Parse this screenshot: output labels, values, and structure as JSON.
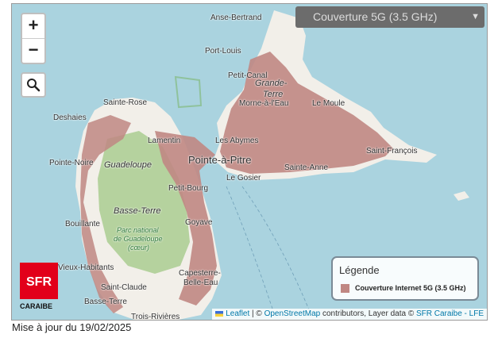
{
  "map": {
    "layer_select": {
      "selected": "Couverture 5G (3.5 GHz)"
    },
    "zoom": {
      "in_label": "+",
      "out_label": "−"
    },
    "places": [
      {
        "name": "Anse-Bertrand",
        "cls": ""
      },
      {
        "name": "Port-Louis",
        "cls": ""
      },
      {
        "name": "Petit-Canal",
        "cls": ""
      },
      {
        "name": "Grande-",
        "cls": "it"
      },
      {
        "name": "Terre",
        "cls": "it"
      },
      {
        "name": "Morne-à-l'Eau",
        "cls": ""
      },
      {
        "name": "Le Moule",
        "cls": ""
      },
      {
        "name": "Sainte-Rose",
        "cls": ""
      },
      {
        "name": "Deshaies",
        "cls": ""
      },
      {
        "name": "Lamentin",
        "cls": ""
      },
      {
        "name": "Les Abymes",
        "cls": ""
      },
      {
        "name": "Pointe-Noire",
        "cls": ""
      },
      {
        "name": "Guadeloupe",
        "cls": "it"
      },
      {
        "name": "Pointe-à-Pitre",
        "cls": "big"
      },
      {
        "name": "Saint-François",
        "cls": ""
      },
      {
        "name": "Sainte-Anne",
        "cls": ""
      },
      {
        "name": "Le Gosier",
        "cls": ""
      },
      {
        "name": "Petit-Bourg",
        "cls": ""
      },
      {
        "name": "Basse-Terre",
        "cls": "it"
      },
      {
        "name": "Bouillante",
        "cls": ""
      },
      {
        "name": "Goyave",
        "cls": ""
      },
      {
        "name": "Parc national",
        "cls": "park"
      },
      {
        "name": "de Guadeloupe",
        "cls": "park"
      },
      {
        "name": "(cœur)",
        "cls": "park"
      },
      {
        "name": "Vieux-Habitants",
        "cls": ""
      },
      {
        "name": "Capesterre-",
        "cls": ""
      },
      {
        "name": "Belle-Eau",
        "cls": ""
      },
      {
        "name": "Saint-Claude",
        "cls": ""
      },
      {
        "name": "Basse-Terre",
        "cls": ""
      },
      {
        "name": "Trois-Rivières",
        "cls": ""
      }
    ],
    "legend": {
      "title": "Légende",
      "items": [
        {
          "label": "Couverture Internet 5G (3.5 GHz)",
          "color": "#c08783"
        }
      ]
    },
    "attribution": {
      "leaflet": "Leaflet",
      "sep1": " | © ",
      "osm": "OpenStreetMap",
      "mid": " contributors, Layer data © ",
      "sfr_link": "SFR Caraibe - LFE"
    },
    "brand": {
      "logo_text": "SFR",
      "sub": "CARAIBE"
    },
    "colors": {
      "sea": "#aad3df",
      "land": "#f2efe9",
      "forest": "#b5d29e",
      "coverage": "#c08783"
    }
  },
  "footer": {
    "updated": "Mise à jour du 19/02/2025"
  }
}
